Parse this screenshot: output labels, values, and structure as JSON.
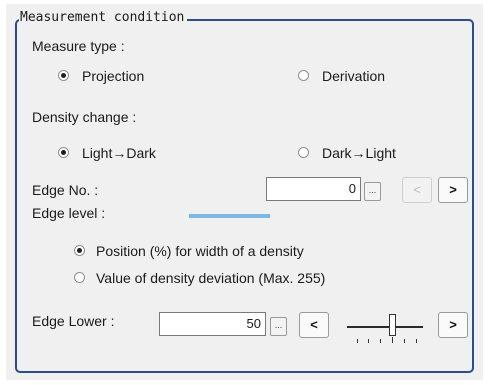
{
  "group": {
    "legend": "Measurement condition"
  },
  "measure_type": {
    "label": "Measure type :",
    "options": [
      {
        "label": "Projection",
        "selected": true
      },
      {
        "label": "Derivation",
        "selected": false
      }
    ]
  },
  "density_change": {
    "label": "Density change :",
    "options": [
      {
        "label": "Light→Dark",
        "selected": true
      },
      {
        "label": "Dark→Light",
        "selected": false
      }
    ]
  },
  "edge_no": {
    "label": "Edge No. :",
    "value": "0",
    "browse_label": "...",
    "prev_label": "<",
    "next_label": ">",
    "prev_enabled": false
  },
  "edge_level": {
    "label": "Edge level :",
    "bar_color": "#7db8e3",
    "options": [
      {
        "label": "Position (%) for width of a density",
        "selected": true
      },
      {
        "label": "Value of density deviation (Max. 255)",
        "selected": false
      }
    ]
  },
  "edge_lower": {
    "label": "Edge Lower :",
    "value": "50",
    "browse_label": "...",
    "dec_label": "<",
    "inc_label": ">",
    "slider_level": 0.5
  },
  "colors": {
    "frame": "#2a4e8c",
    "panel_bg": "#f0f0f0"
  }
}
